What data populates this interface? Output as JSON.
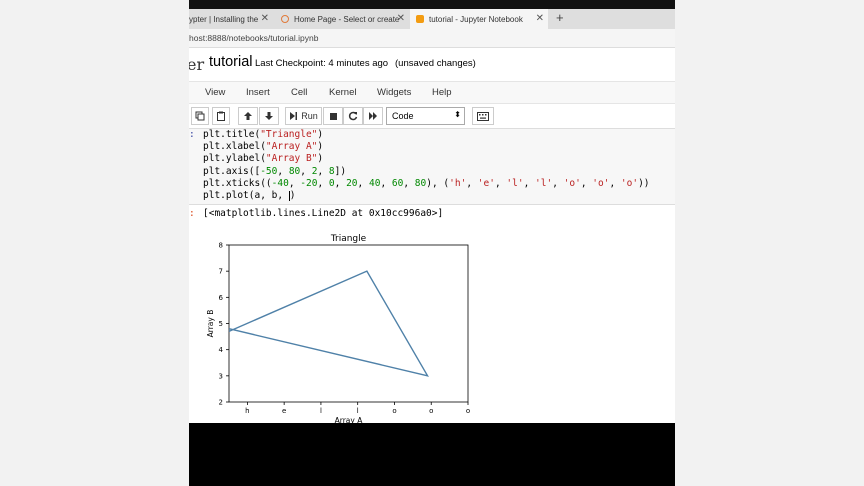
{
  "browser": {
    "tabs": [
      {
        "label": "ypter | Installing the",
        "close": "✕"
      },
      {
        "label": "Home Page - Select or create",
        "close": "✕"
      },
      {
        "label": "tutorial - Jupyter Notebook",
        "close": "✕"
      }
    ],
    "new_tab": "+",
    "url": "host:8888/notebooks/tutorial.ipynb"
  },
  "header": {
    "logo_fragment": "er",
    "notebook_name": "tutorial",
    "checkpoint": "Last Checkpoint: 4 minutes ago",
    "unsaved": "(unsaved changes)"
  },
  "menu": [
    "View",
    "Insert",
    "Cell",
    "Kernel",
    "Widgets",
    "Help"
  ],
  "toolbar": {
    "run_label": "Run",
    "cell_type": "Code"
  },
  "cell": {
    "prompt": ":",
    "lines": [
      [
        "plt.title(",
        "\"Triangle\"",
        ")"
      ],
      [
        "plt.xlabel(",
        "\"Array A\"",
        ")"
      ],
      [
        "plt.ylabel(",
        "\"Array B\"",
        ")"
      ],
      [
        "plt.axis([",
        "-50",
        ", ",
        "80",
        ", ",
        "2",
        ", ",
        "8",
        "])"
      ],
      [
        "plt.xticks((",
        "-40",
        ", ",
        "-20",
        ", ",
        "0",
        ", ",
        "20",
        ", ",
        "40",
        ", ",
        "60",
        ", ",
        "80",
        "), (",
        "'h'",
        ", ",
        "'e'",
        ", ",
        "'l'",
        ", ",
        "'l'",
        ", ",
        "'o'",
        ", ",
        "'o'",
        ", ",
        "'o'",
        "))"
      ],
      [
        "plt.plot(a, b, ",
        ")"
      ]
    ]
  },
  "output": {
    "prompt": ":",
    "text": "[<matplotlib.lines.Line2D at 0x10cc996a0>]"
  },
  "chart_data": {
    "type": "line",
    "title": "Triangle",
    "xlabel": "Array A",
    "ylabel": "Array B",
    "xlim": [
      -50,
      80
    ],
    "ylim": [
      2,
      8
    ],
    "x_ticks": [
      -40,
      -20,
      0,
      20,
      40,
      60,
      80
    ],
    "x_tick_labels": [
      "h",
      "e",
      "l",
      "l",
      "o",
      "o",
      "o"
    ],
    "y_ticks": [
      2,
      3,
      4,
      5,
      6,
      7,
      8
    ],
    "y_tick_labels": [
      "2",
      "3",
      "4",
      "5",
      "6",
      "7",
      "8"
    ],
    "series": [
      {
        "x": [
          -50,
          25,
          58,
          -50
        ],
        "y": [
          4.7,
          7,
          3,
          4.8
        ],
        "color": "#4f81a8"
      }
    ],
    "grid": false
  }
}
